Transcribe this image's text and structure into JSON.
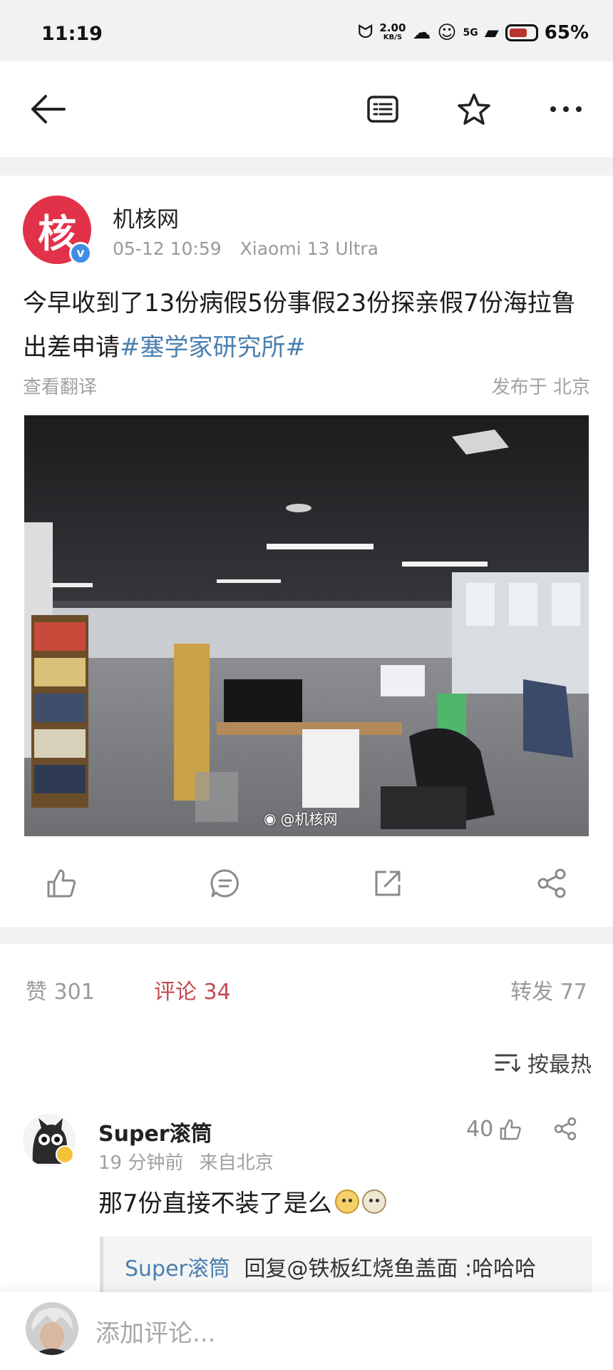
{
  "status_bar": {
    "time": "11:19",
    "net_speed_value": "2.00",
    "net_speed_unit": "KB/S",
    "network": "5G",
    "battery": "65%"
  },
  "nav": {
    "back_icon": "back-arrow-icon",
    "reader_icon": "reader-mode-icon",
    "favorite_icon": "star-icon",
    "more_icon": "more-icon"
  },
  "post": {
    "author": {
      "name": "机核网",
      "avatar_char": "核",
      "verified": true
    },
    "date": "05-12 10:59",
    "device": "Xiaomi 13 Ultra",
    "text": "今早收到了13份病假5份事假23份探亲假7份海拉鲁出差申请",
    "hashtag": "#塞学家研究所#",
    "translate": "查看翻译",
    "location": "发布于 北京",
    "image_watermark": "@机核网"
  },
  "stats": {
    "likes": "赞 301",
    "comments": "评论 34",
    "reposts": "转发 77"
  },
  "comments": {
    "sort_label": "按最热",
    "items": [
      {
        "user": "Super滚筒",
        "time": "19 分钟前",
        "from": "来自北京",
        "text": "那7份直接不装了是么",
        "likes": "40",
        "reply_user": "Super滚筒",
        "reply_text": "回复@铁板红烧鱼盖面 :哈哈哈"
      }
    ]
  },
  "bottom": {
    "placeholder": "添加评论..."
  },
  "colors": {
    "accent_red": "#c44a52",
    "link_blue": "#4a7fae",
    "avatar_red": "#e2324a",
    "verified_blue": "#3f8ee3"
  }
}
